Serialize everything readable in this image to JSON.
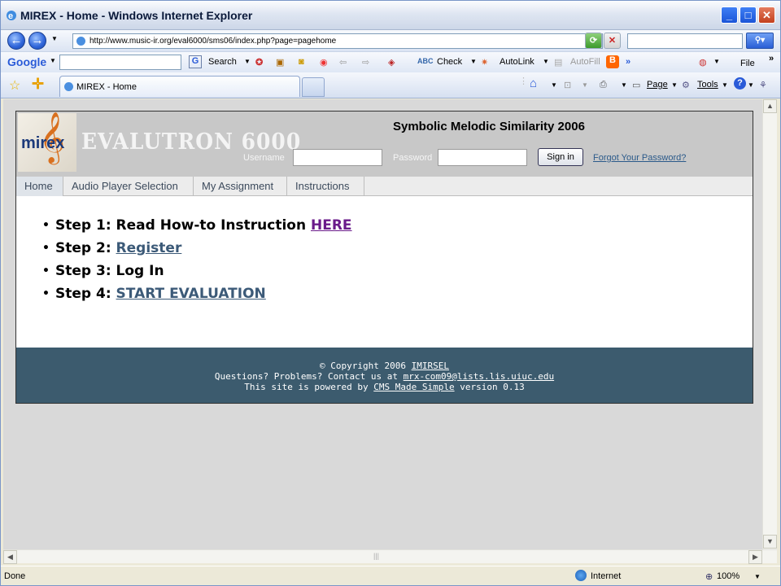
{
  "window": {
    "title": "MIREX - Home - Windows Internet Explorer"
  },
  "address_bar": {
    "url": "http://www.music-ir.org/eval6000/sms06/index.php?page=pagehome"
  },
  "google_bar": {
    "brand": "Google",
    "search": "Search",
    "check": "Check",
    "autolink": "AutoLink",
    "autofill": "AutoFill",
    "more": "»",
    "file": "File"
  },
  "tab": {
    "label": "MIREX - Home"
  },
  "command_bar": {
    "page": "Page",
    "tools": "Tools"
  },
  "site": {
    "logo_text": "mirex",
    "evaltitle": "EVALUTRON 6000",
    "title": "Symbolic Melodic Similarity 2006",
    "username_label": "Username",
    "password_label": "Password",
    "signin": "Sign in",
    "forgot": "Forgot Your Password?"
  },
  "menu": [
    {
      "label": "Home"
    },
    {
      "label": "Audio Player Selection"
    },
    {
      "label": "My Assignment"
    },
    {
      "label": "Instructions"
    }
  ],
  "steps": [
    {
      "text": "Step 1: Read How-to Instruction ",
      "link": "HERE"
    },
    {
      "text": "Step 2: ",
      "link": "Register"
    },
    {
      "text": "Step 3: Log In",
      "link": ""
    },
    {
      "text": "Step 4: ",
      "link": "START EVALUATION"
    }
  ],
  "footer": {
    "line1_prefix": "© Copyright 2006 ",
    "line1_link": "IMIRSEL",
    "line2_prefix": "Questions? Problems? Contact us at ",
    "line2_link": "mrx-com09@lists.lis.uiuc.edu",
    "line3_prefix": "This site is powered by ",
    "line3_link": "CMS Made Simple",
    "line3_suffix": " version 0.13"
  },
  "status": {
    "left": "Done",
    "zone": "Internet",
    "zoom": "100%"
  }
}
